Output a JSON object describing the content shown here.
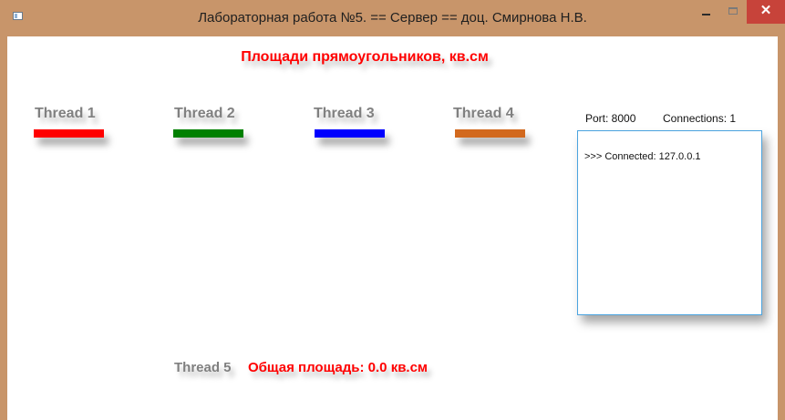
{
  "window": {
    "title": "Лабораторная работа №5. == Сервер == доц. Смирнова Н.В.",
    "close_glyph": "✕"
  },
  "heading": "Площади прямоугольников, кв.см",
  "threads": [
    {
      "label": "Thread 1",
      "color": "#ff0000"
    },
    {
      "label": "Thread 2",
      "color": "#008000"
    },
    {
      "label": "Thread 3",
      "color": "#0000ff"
    },
    {
      "label": "Thread 4",
      "color": "#d2691e"
    }
  ],
  "server": {
    "port_label": "Port: 8000",
    "connections_label": "Connections:  1",
    "log": [
      ">>> Connected: 127.0.0.1"
    ]
  },
  "footer": {
    "thread5_label": "Thread 5",
    "total_label": "Общая площадь: 0.0 кв.см"
  },
  "icons": {
    "app": "app-icon",
    "minimize": "minimize-icon",
    "maximize": "maximize-icon",
    "close": "close-icon"
  }
}
